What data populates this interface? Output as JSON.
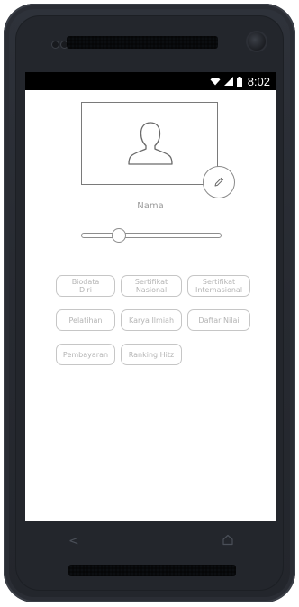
{
  "status_bar": {
    "time": "8:02",
    "icons": [
      "wifi-icon",
      "signal-icon",
      "battery-icon"
    ]
  },
  "profile": {
    "name_label": "Nama",
    "avatar_icon": "person-silhouette-icon",
    "edit_icon": "pencil-icon"
  },
  "slider": {
    "value_fraction": 0.27
  },
  "menu": {
    "items": [
      {
        "label": "Biodata\nDiri"
      },
      {
        "label": "Sertifikat\nNasional"
      },
      {
        "label": "Sertifikat\nInternasional"
      },
      {
        "label": "Pelatihan"
      },
      {
        "label": "Karya Ilmiah"
      },
      {
        "label": "Daftar Nilai"
      },
      {
        "label": "Pembayaran"
      },
      {
        "label": "Ranking Hitz"
      }
    ]
  },
  "nav": {
    "back_icon": "back-chevron-icon",
    "home_icon": "home-icon"
  },
  "colors": {
    "device_body": "#2b2e35",
    "screen_bg": "#ffffff",
    "status_bar_bg": "#000000",
    "button_border": "#c6c6c6",
    "button_text": "#b4b4b4"
  }
}
